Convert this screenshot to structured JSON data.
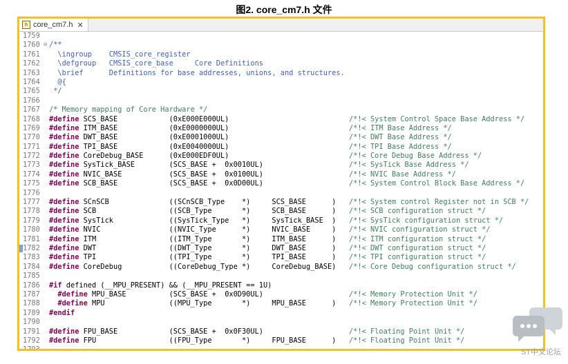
{
  "caption": "图2. core_cm7.h 文件",
  "tab": {
    "title": "core_cm7.h",
    "close": "✕"
  },
  "watermark": "ST中文论坛",
  "lines": [
    {
      "n": "1759",
      "segs": []
    },
    {
      "n": "1760",
      "fold": "⊖",
      "segs": [
        {
          "t": "/**",
          "c": "dc"
        }
      ]
    },
    {
      "n": "1761",
      "segs": [
        {
          "t": "  \\ingroup    CMSIS_core_register",
          "c": "dc"
        }
      ]
    },
    {
      "n": "1762",
      "segs": [
        {
          "t": "  \\defgroup   CMSIS_core_base     Core Definitions",
          "c": "dc"
        }
      ]
    },
    {
      "n": "1763",
      "segs": [
        {
          "t": "  \\brief      Definitions for base addresses, unions, and structures.",
          "c": "dc"
        }
      ]
    },
    {
      "n": "1764",
      "segs": [
        {
          "t": "  @{",
          "c": "dc"
        }
      ]
    },
    {
      "n": "1765",
      "segs": [
        {
          "t": " */",
          "c": "dc"
        }
      ]
    },
    {
      "n": "1766",
      "segs": []
    },
    {
      "n": "1767",
      "segs": [
        {
          "t": "/* Memory mapping of Core Hardware */",
          "c": "cm"
        }
      ]
    },
    {
      "n": "1768",
      "segs": [
        {
          "t": "#define",
          "c": "kw"
        },
        {
          "t": " SCS_BASE            (0xE000E000UL)                            "
        },
        {
          "t": "/*!< System Control Space Base Address */",
          "c": "cm"
        }
      ]
    },
    {
      "n": "1769",
      "segs": [
        {
          "t": "#define",
          "c": "kw"
        },
        {
          "t": " ITM_BASE            (0xE0000000UL)                            "
        },
        {
          "t": "/*!< ITM Base Address */",
          "c": "cm"
        }
      ]
    },
    {
      "n": "1770",
      "segs": [
        {
          "t": "#define",
          "c": "kw"
        },
        {
          "t": " DWT_BASE            (0xE0001000UL)                            "
        },
        {
          "t": "/*!< DWT Base Address */",
          "c": "cm"
        }
      ]
    },
    {
      "n": "1771",
      "segs": [
        {
          "t": "#define",
          "c": "kw"
        },
        {
          "t": " TPI_BASE            (0xE0040000UL)                            "
        },
        {
          "t": "/*!< TPI Base Address */",
          "c": "cm"
        }
      ]
    },
    {
      "n": "1772",
      "segs": [
        {
          "t": "#define",
          "c": "kw"
        },
        {
          "t": " CoreDebug_BASE      (0xE000EDF0UL)                            "
        },
        {
          "t": "/*!< Core Debug Base Address */",
          "c": "cm"
        }
      ]
    },
    {
      "n": "1773",
      "segs": [
        {
          "t": "#define",
          "c": "kw"
        },
        {
          "t": " SysTick_BASE        (SCS_BASE +  0x0010UL)                    "
        },
        {
          "t": "/*!< SysTick Base Address */",
          "c": "cm"
        }
      ]
    },
    {
      "n": "1774",
      "segs": [
        {
          "t": "#define",
          "c": "kw"
        },
        {
          "t": " NVIC_BASE           (SCS_BASE +  0x0100UL)                    "
        },
        {
          "t": "/*!< NVIC Base Address */",
          "c": "cm"
        }
      ]
    },
    {
      "n": "1775",
      "segs": [
        {
          "t": "#define",
          "c": "kw"
        },
        {
          "t": " SCB_BASE            (SCS_BASE +  0x0D00UL)                    "
        },
        {
          "t": "/*!< System Control Block Base Address */",
          "c": "cm"
        }
      ]
    },
    {
      "n": "1776",
      "segs": []
    },
    {
      "n": "1777",
      "segs": [
        {
          "t": "#define",
          "c": "kw"
        },
        {
          "t": " SCnSCB              ((SCnSCB_Type    *)     SCS_BASE      )   "
        },
        {
          "t": "/*!< System control Register not in SCB */",
          "c": "cm"
        }
      ]
    },
    {
      "n": "1778",
      "segs": [
        {
          "t": "#define",
          "c": "kw"
        },
        {
          "t": " SCB                 ((SCB_Type       *)     SCB_BASE      )   "
        },
        {
          "t": "/*!< SCB configuration struct */",
          "c": "cm"
        }
      ]
    },
    {
      "n": "1779",
      "segs": [
        {
          "t": "#define",
          "c": "kw"
        },
        {
          "t": " SysTick             ((SysTick_Type   *)     SysTick_BASE  )   "
        },
        {
          "t": "/*!< SysTick configuration struct */",
          "c": "cm"
        }
      ]
    },
    {
      "n": "1780",
      "segs": [
        {
          "t": "#define",
          "c": "kw"
        },
        {
          "t": " NVIC                ((NVIC_Type      *)     NVIC_BASE     )   "
        },
        {
          "t": "/*!< NVIC configuration struct */",
          "c": "cm"
        }
      ]
    },
    {
      "n": "1781",
      "segs": [
        {
          "t": "#define",
          "c": "kw"
        },
        {
          "t": " ITM                 ((ITM_Type       *)     ITM_BASE      )   "
        },
        {
          "t": "/*!< ITM configuration struct */",
          "c": "cm"
        }
      ]
    },
    {
      "n": "1782",
      "marker": true,
      "segs": [
        {
          "t": "#define",
          "c": "kw"
        },
        {
          "t": " DWT                 ((DWT_Type       *)     DWT_BASE      )   "
        },
        {
          "t": "/*!< DWT configuration struct */",
          "c": "cm"
        }
      ]
    },
    {
      "n": "1783",
      "segs": [
        {
          "t": "#define",
          "c": "kw"
        },
        {
          "t": " TPI                 ((TPI_Type       *)     TPI_BASE      )   "
        },
        {
          "t": "/*!< TPI configuration struct */",
          "c": "cm"
        }
      ]
    },
    {
      "n": "1784",
      "segs": [
        {
          "t": "#define",
          "c": "kw"
        },
        {
          "t": " CoreDebug           ((CoreDebug_Type *)     CoreDebug_BASE)   "
        },
        {
          "t": "/*!< Core Debug configuration struct */",
          "c": "cm"
        }
      ]
    },
    {
      "n": "1785",
      "segs": []
    },
    {
      "n": "1786",
      "segs": [
        {
          "t": "#if",
          "c": "kw"
        },
        {
          "t": " defined (__MPU_PRESENT) && (__MPU_PRESENT == 1U)"
        }
      ]
    },
    {
      "n": "1787",
      "segs": [
        {
          "t": "  "
        },
        {
          "t": "#define",
          "c": "kw"
        },
        {
          "t": " MPU_BASE          (SCS_BASE +  0x0D90UL)                    "
        },
        {
          "t": "/*!< Memory Protection Unit */",
          "c": "cm"
        }
      ]
    },
    {
      "n": "1788",
      "segs": [
        {
          "t": "  "
        },
        {
          "t": "#define",
          "c": "kw"
        },
        {
          "t": " MPU               ((MPU_Type       *)     MPU_BASE      )   "
        },
        {
          "t": "/*!< Memory Protection Unit */",
          "c": "cm"
        }
      ]
    },
    {
      "n": "1789",
      "segs": [
        {
          "t": "#endif",
          "c": "kw"
        }
      ]
    },
    {
      "n": "1790",
      "segs": []
    },
    {
      "n": "1791",
      "segs": [
        {
          "t": "#define",
          "c": "kw"
        },
        {
          "t": " FPU_BASE            (SCS_BASE +  0x0F30UL)                    "
        },
        {
          "t": "/*!< Floating Point Unit */",
          "c": "cm"
        }
      ]
    },
    {
      "n": "1792",
      "segs": [
        {
          "t": "#define",
          "c": "kw"
        },
        {
          "t": " FPU                 ((FPU_Type       *)     FPU_BASE      )   "
        },
        {
          "t": "/*!< Floating Point Unit */",
          "c": "cm"
        }
      ]
    },
    {
      "n": "1793",
      "segs": []
    }
  ]
}
